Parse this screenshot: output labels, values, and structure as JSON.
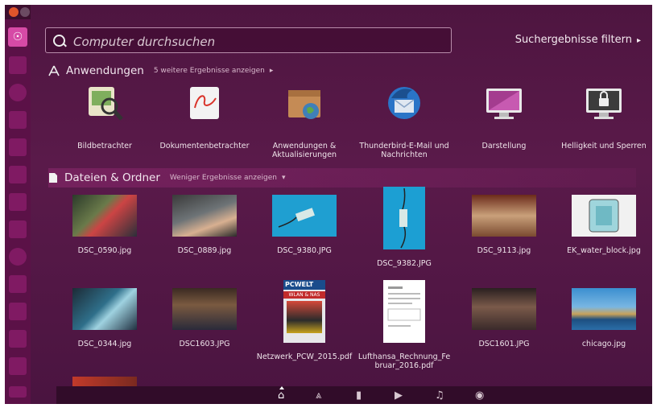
{
  "search": {
    "placeholder": "Computer durchsuchen",
    "filter_label": "Suchergebnisse filtern"
  },
  "sections": {
    "apps": {
      "title": "Anwendungen",
      "more": "5 weitere Ergebnisse anzeigen",
      "more_arrow": "▸",
      "icon": "apps-icon"
    },
    "files": {
      "title": "Dateien & Ordner",
      "more": "Weniger Ergebnisse anzeigen",
      "more_arrow": "▾",
      "icon": "document-icon"
    }
  },
  "apps": [
    {
      "label": "Bildbetrachter",
      "icon": "image-viewer-icon"
    },
    {
      "label": "Dokumentenbetrachter",
      "icon": "document-viewer-icon"
    },
    {
      "label": "Anwendungen & Aktualisierungen",
      "icon": "software-updates-icon"
    },
    {
      "label": "Thunderbird-E-Mail und Nachrichten",
      "icon": "thunderbird-icon"
    },
    {
      "label": "Darstellung",
      "icon": "appearance-icon"
    },
    {
      "label": "Helligkeit und Sperren",
      "icon": "brightness-lock-icon"
    }
  ],
  "files": [
    {
      "label": "DSC_0590.jpg"
    },
    {
      "label": "DSC_0889.jpg"
    },
    {
      "label": "DSC_9380.JPG"
    },
    {
      "label": "DSC_9382.JPG"
    },
    {
      "label": "DSC_9113.jpg"
    },
    {
      "label": "EK_water_block.jpg"
    },
    {
      "label": "DSC_0344.jpg"
    },
    {
      "label": "DSC1603.JPG"
    },
    {
      "label": "Netzwerk_PCW_2015.pdf"
    },
    {
      "label": "Lufthansa_Rechnung_Februar_2016.pdf"
    },
    {
      "label": "DSC1601.JPG"
    },
    {
      "label": "chicago.jpg"
    }
  ],
  "thumb_texts": {
    "magazine_brand": "PCWELT",
    "magazine_headline": "WLAN & NAS"
  },
  "bottom_lenses": [
    "home-icon",
    "apps-icon",
    "files-icon",
    "video-icon",
    "music-icon",
    "photo-icon"
  ],
  "colors": {
    "accent": "#d64aa6",
    "background": "#4e1540",
    "launcher": "#5b1147"
  }
}
